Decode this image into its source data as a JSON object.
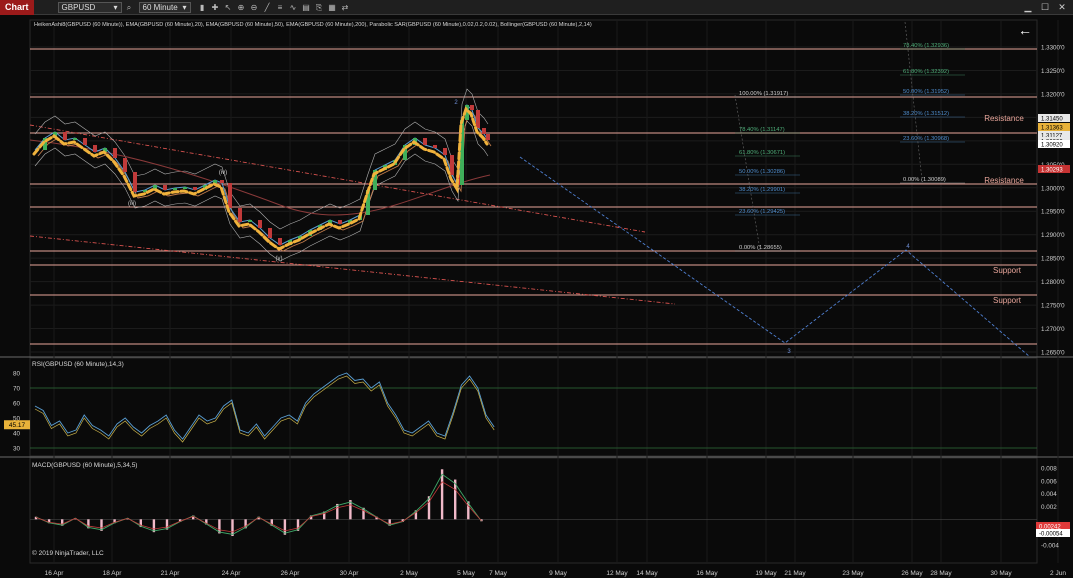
{
  "toolbar": {
    "chart_tab": "Chart",
    "instrument": "GBPUSD",
    "timeframe": "60 Minute"
  },
  "price_panel": {
    "indicator_header": "HeikenAshi8(GBPUSD (60 Minute)), EMA(GBPUSD (60 Minute),20), EMA(GBPUSD (60 Minute),50), EMA(GBPUSD (60 Minute),200), Parabolic SAR(GBPUSD (60 Minute),0.02,0.2,0.02), Bollinger(GBPUSD (60 Minute),2,14)",
    "price_ticks": [
      "1.3300'0",
      "1.3250'0",
      "1.3200'0",
      "1.3150'0",
      "1.3100'0",
      "1.3050'0",
      "1.3000'0",
      "1.2950'0",
      "1.2900'0",
      "1.2850'0",
      "1.2800'0",
      "1.2750'0",
      "1.2700'0",
      "1.2650'0"
    ],
    "price_badges": [
      {
        "text": "1.31450",
        "bg": "#e8e8e8",
        "fg": "#000000"
      },
      {
        "text": "1.31363",
        "bg": "#e8b23a",
        "fg": "#000000"
      },
      {
        "text": "1.31127",
        "bg": "#e8e8e8",
        "fg": "#000000"
      },
      {
        "text": "1.30000",
        "bg": "#e8e8e8",
        "fg": "#000000"
      },
      {
        "text": "1.30920",
        "bg": "#ffffff",
        "fg": "#000000"
      },
      {
        "text": "1.30293",
        "bg": "#c63333",
        "fg": "#ffffff"
      }
    ],
    "zone_labels": [
      "Resistance",
      "Resistance",
      "Support",
      "Support"
    ],
    "wave_labels": [
      "(iii)",
      "(iv)",
      "(v)",
      "2",
      "3",
      "4"
    ],
    "fib_left": [
      "100.00% (1.31917)",
      "78.40% (1.31147)",
      "61.80% (1.30671)",
      "50.00% (1.30286)",
      "38.20% (1.29901)",
      "23.60% (1.29425)",
      "0.00% (1.28655)"
    ],
    "fib_right": [
      "78.40% (1.32936)",
      "61.80% (1.32392)",
      "50.00% (1.31952)",
      "38.20% (1.31512)",
      "23.60% (1.30968)",
      "0.00% (1.30089)"
    ],
    "copyright": "© 2019 NinjaTrader, LLC"
  },
  "rsi_panel": {
    "header": "RSI(GBPUSD (60 Minute),14,3)",
    "ticks": [
      "80",
      "70",
      "60",
      "50",
      "40",
      "30"
    ],
    "current_value": "45.17"
  },
  "macd_panel": {
    "header": "MACD(GBPUSD (60 Minute),5,34,5)",
    "ticks": [
      "0.008",
      "0.006",
      "0.004",
      "0.002",
      "-0.002",
      "-0.004"
    ],
    "badges": [
      {
        "text": "0.00242",
        "bg": "#e03a3a",
        "fg": "#ffffff"
      },
      {
        "text": "-0.00054",
        "bg": "#ffffff",
        "fg": "#000000"
      }
    ]
  },
  "x_axis": {
    "dates": [
      "16 Apr",
      "18 Apr",
      "21 Apr",
      "24 Apr",
      "26 Apr",
      "30 Apr",
      "2 May",
      "5 May",
      "7 May",
      "9 May",
      "12 May",
      "14 May",
      "16 May",
      "19 May",
      "21 May",
      "23 May",
      "26 May",
      "28 May",
      "30 May",
      "2 Jun"
    ]
  },
  "colors": {
    "background": "#0a0a0a",
    "zone_line": "#e8a59a",
    "fib_line": "#ffffff",
    "ema_yellow": "#f0b23c",
    "projection": "#4f7fd0",
    "trendline": "#d9534f"
  }
}
